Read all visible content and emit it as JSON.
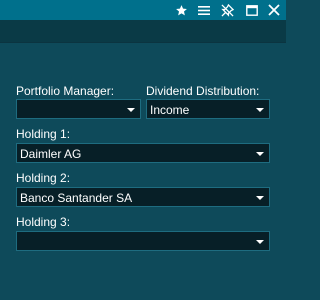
{
  "titlebar": {
    "icons": [
      "star-icon",
      "menu-icon",
      "unpin-icon",
      "maximize-icon",
      "close-icon"
    ]
  },
  "form": {
    "portfolio_manager": {
      "label": "Portfolio Manager:",
      "value": ""
    },
    "dividend_distribution": {
      "label": "Dividend Distribution:",
      "value": "Income"
    },
    "holding1": {
      "label": "Holding 1:",
      "value": "Daimler AG"
    },
    "holding2": {
      "label": "Holding 2:",
      "value": "Banco Santander SA"
    },
    "holding3": {
      "label": "Holding 3:",
      "value": ""
    }
  },
  "colors": {
    "titlebar_bg": "#00708c",
    "window_bg": "#0e4a5a",
    "field_bg": "#071f27",
    "field_border": "#1e6c80"
  }
}
